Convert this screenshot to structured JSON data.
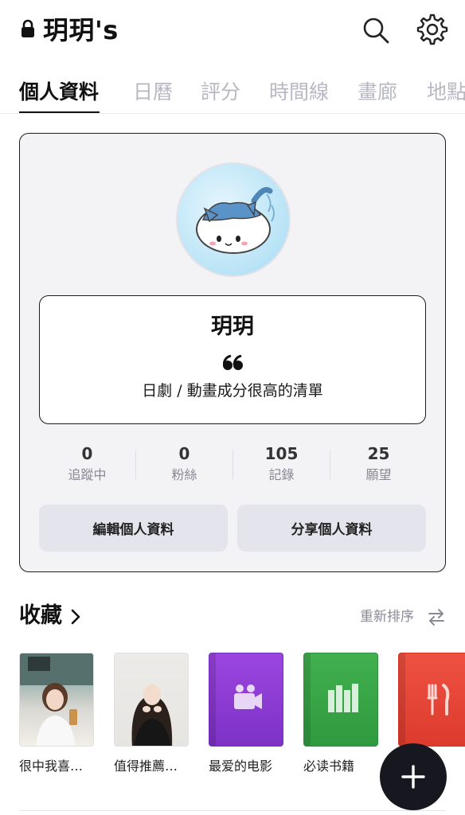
{
  "header": {
    "title": "玥玥's"
  },
  "tabs": [
    {
      "label": "個人資料"
    },
    {
      "label": "日曆"
    },
    {
      "label": "評分"
    },
    {
      "label": "時間線"
    },
    {
      "label": "畫廊"
    },
    {
      "label": "地點"
    }
  ],
  "profile": {
    "name": "玥玥",
    "bio": "日劇 / 動畫成分很高的清單",
    "stats": [
      {
        "value": "0",
        "label": "追蹤中"
      },
      {
        "value": "0",
        "label": "粉絲"
      },
      {
        "value": "105",
        "label": "記錄"
      },
      {
        "value": "25",
        "label": "願望"
      }
    ],
    "edit_button": "編輯個人資料",
    "share_button": "分享個人資料"
  },
  "collections": {
    "title": "收藏",
    "reorder_label": "重新排序",
    "items": [
      {
        "label": "很中我喜…"
      },
      {
        "label": "值得推薦…"
      },
      {
        "label": "最爱的电影",
        "color": "#8f3fd6"
      },
      {
        "label": "必读书籍",
        "color": "#3aa54a"
      },
      {
        "label": "",
        "color": "#e8473a"
      }
    ]
  },
  "colors": {
    "accent": "#111111",
    "tab_inactive": "#b8b8c4",
    "card_background": "#f3f3f6",
    "button_background": "#e4e4ec",
    "fab_background": "#17171f"
  }
}
